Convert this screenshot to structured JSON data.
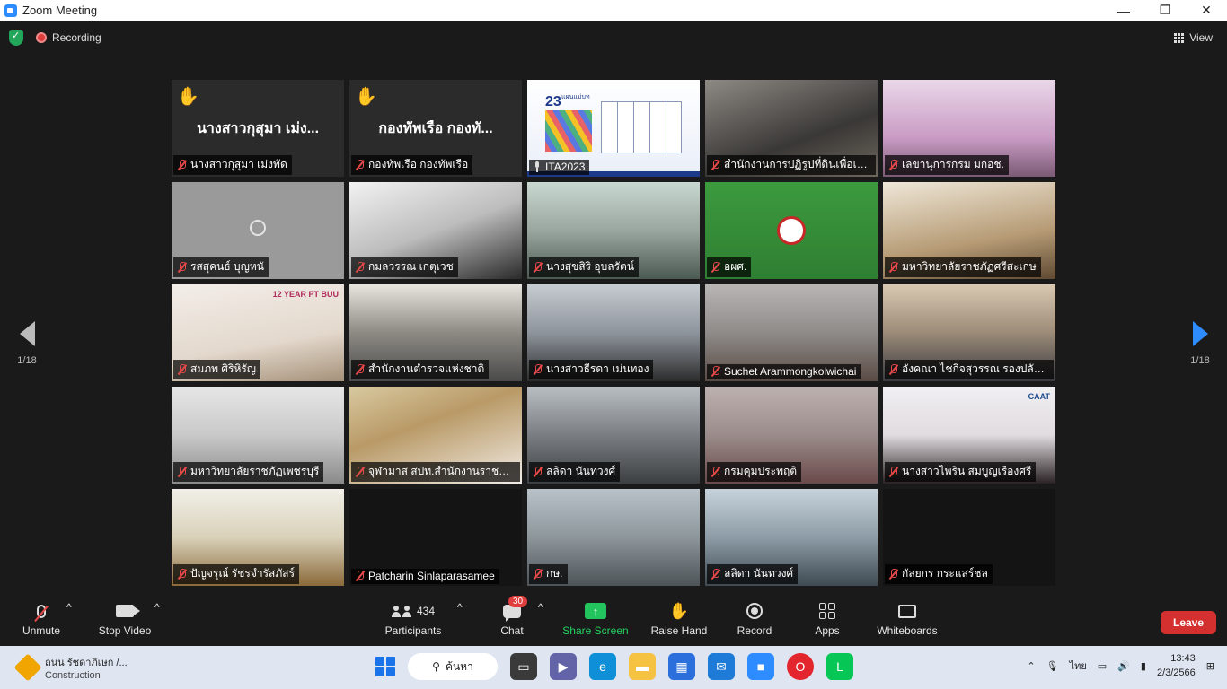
{
  "window": {
    "title": "Zoom Meeting"
  },
  "top": {
    "recording_label": "Recording",
    "view_label": "View"
  },
  "nav": {
    "page_left": "1/18",
    "page_right": "1/18"
  },
  "tiles": [
    {
      "name": "นางสาวกุสุมา เม่งพัด",
      "big_name": "นางสาวกุสุมา เม่ง...",
      "hand": true
    },
    {
      "name": "กองทัพเรือ กองทัพเรือ",
      "big_name": "กองทัพเรือ กองทั...",
      "hand": true
    },
    {
      "name": "ITA2023",
      "active": true,
      "slide_number": "23",
      "slide_title": "แผนแม่บท"
    },
    {
      "name": "สำนักงานการปฏิรูปที่ดินเพื่อเกษ..."
    },
    {
      "name": "เลขานุการกรม มกอช."
    },
    {
      "name": "รสสุคนธ์ บุญหนั"
    },
    {
      "name": "กมลวรรณ เกตุเวช"
    },
    {
      "name": "นางสุขสิริ อุบลรัตน์"
    },
    {
      "name": "อผศ."
    },
    {
      "name": "มหาวิทยาลัยราชภัฏศรีสะเกษ"
    },
    {
      "name": "สมภพ ศิริหิรัญ",
      "logo_text": "12 YEAR PT BUU"
    },
    {
      "name": "สำนักงานตำรวจแห่งชาติ"
    },
    {
      "name": "นางสาวธีรดา เม่นทอง"
    },
    {
      "name": "Suchet Arammongkolwichai"
    },
    {
      "name": "อังคณา ไชกิจสุวรรณ รองปลัดก..."
    },
    {
      "name": "มหาวิทยาลัยราชภัฏเพชรบุรี"
    },
    {
      "name": "จุฬามาส สปท.สำนักงานราชบัณ..."
    },
    {
      "name": "ลลิดา นันทวงศ์"
    },
    {
      "name": "กรมคุมประพฤติ"
    },
    {
      "name": "นางสาวไพริน สมบูญเรืองศรี",
      "logo_text": "CAAT"
    },
    {
      "name": "ปัญจรุณ์ รัชรจำรัสภัสร์"
    },
    {
      "name": "Patcharin Sinlaparasamee"
    },
    {
      "name": "กษ."
    },
    {
      "name": "ลลิดา นันทวงศ์"
    },
    {
      "name": "กัลยกร กระแสร์ชล"
    }
  ],
  "toolbar": {
    "unmute": "Unmute",
    "stop_video": "Stop Video",
    "participants": "Participants",
    "participants_count": "434",
    "chat": "Chat",
    "chat_badge": "30",
    "share": "Share Screen",
    "raise_hand": "Raise Hand",
    "record": "Record",
    "apps": "Apps",
    "whiteboards": "Whiteboards",
    "leave": "Leave"
  },
  "taskbar": {
    "weather_title": "ถนน รัชดาภิเษก /...",
    "weather_sub": "Construction",
    "search": "ค้นหา",
    "lang": "ไทย",
    "time": "13:43",
    "date": "2/3/2566"
  },
  "colors": {
    "accent": "#2d8cff",
    "leave": "#d3302f",
    "share": "#23c45e",
    "active_outline": "#e8e66a"
  }
}
